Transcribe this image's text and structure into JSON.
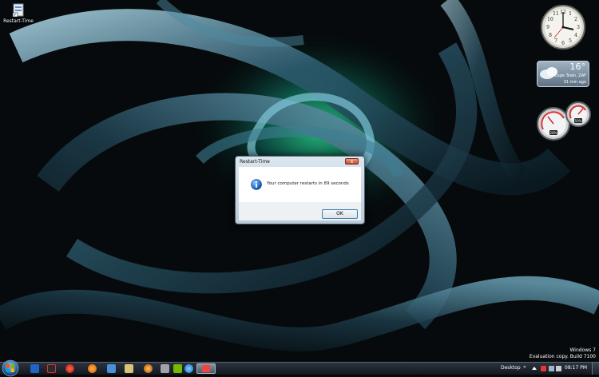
{
  "desktop": {
    "icon_label": "Restart-Time",
    "watermark": {
      "line1": "Windows 7",
      "line2": "Evaluation copy. Build 7100"
    }
  },
  "gadgets": {
    "weather": {
      "temperature": "16°",
      "location": "Cape Town, ZAF",
      "updated": "31 min ago"
    },
    "meters": {
      "cpu": "28%",
      "memory": "50%"
    }
  },
  "dialog": {
    "title": "Restart-Time",
    "close": "x",
    "message": "Your computer restarts in 89 seconds",
    "ok_label": "OK"
  },
  "taskbar": {
    "desktop_label": "Desktop",
    "chevron": "»",
    "time": "08:17 PM",
    "pinned_icons": [
      "ie-icon",
      "media-player-icon",
      "opera-icon",
      "firefox-icon",
      "messenger-icon",
      "explorer-icon",
      "chrome-icon",
      "tool-icon",
      "nvidia-icon",
      "globe-icon",
      "restart-time-icon"
    ]
  }
}
